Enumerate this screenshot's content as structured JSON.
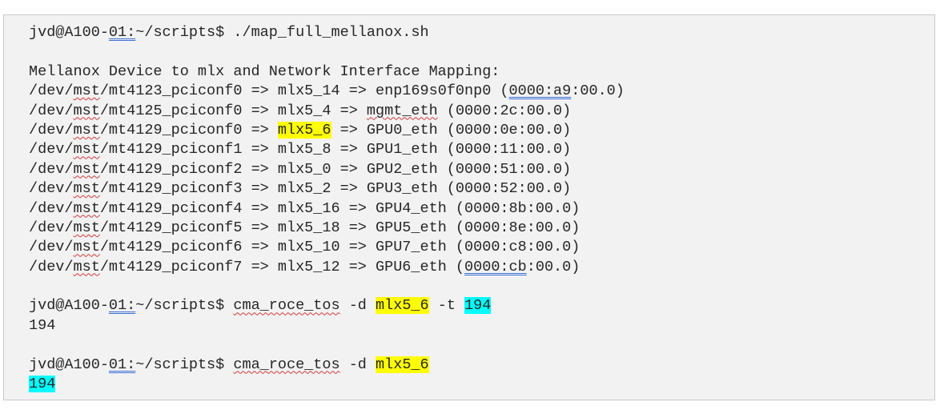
{
  "terminal": {
    "prompt_user_host_a": "jvd@A100-",
    "prompt_host_num": "01:",
    "prompt_path": "~/scripts$ ",
    "cmd1": "./map_full_mellanox.sh",
    "header": "Mellanox Device to mlx and Network Interface Mapping:",
    "mapping": [
      {
        "pre": "/dev/",
        "mst": "mst",
        "dev": "/mt4123_pciconf0",
        "mid1": " => mlx5_14 => ",
        "iface": "enp169s0f0np0",
        "pci_a": " (",
        "pci_dom": "0000:a9",
        "pci_rest": ":00.0)"
      },
      {
        "pre": "/dev/",
        "mst": "mst",
        "dev": "/mt4125_pciconf0",
        "mid1": " => mlx5_4 => ",
        "iface": "mgmt_eth",
        "pci": " (0000:2c:00.0)"
      },
      {
        "pre": "/dev/",
        "mst": "mst",
        "dev": "/mt4129_pciconf0",
        "mid0": " => ",
        "mlx": "mlx5_6",
        "mid1": " => GPU0_eth (0000:0e:00.0)"
      },
      {
        "pre": "/dev/",
        "mst": "mst",
        "dev": "/mt4129_pciconf1",
        "rest": " => mlx5_8 => GPU1_eth (0000:11:00.0)"
      },
      {
        "pre": "/dev/",
        "mst": "mst",
        "dev": "/mt4129_pciconf2",
        "rest": " => mlx5_0 => GPU2_eth (0000:51:00.0)"
      },
      {
        "pre": "/dev/",
        "mst": "mst",
        "dev": "/mt4129_pciconf3",
        "rest": " => mlx5_2 => GPU3_eth (0000:52:00.0)"
      },
      {
        "pre": "/dev/",
        "mst": "mst",
        "dev": "/mt4129_pciconf4",
        "rest": " => mlx5_16 => GPU4_eth (0000:8b:00.0)"
      },
      {
        "pre": "/dev/",
        "mst": "mst",
        "dev": "/mt4129_pciconf5",
        "rest": " => mlx5_18 => GPU5_eth (0000:8e:00.0)"
      },
      {
        "pre": "/dev/",
        "mst": "mst",
        "dev": "/mt4129_pciconf6",
        "rest": " => mlx5_10 => GPU7_eth (0000:c8:00.0)"
      },
      {
        "pre": "/dev/",
        "mst": "mst",
        "dev": "/mt4129_pciconf7",
        "rest_a": " => mlx5_12 => GPU6_eth (",
        "pci_dom": "0000:cb",
        "rest_b": ":00.0)"
      }
    ],
    "cmd2_name": "cma_roce_tos",
    "cmd2_flag_d": " -d ",
    "cmd2_dev": "mlx5_6",
    "cmd2_flag_t": " -t ",
    "cmd2_tos": "194",
    "output2": "194",
    "cmd3_name": "cma_roce_tos",
    "cmd3_flag_d": " -d ",
    "cmd3_dev": "mlx5_6",
    "output3": "194"
  }
}
